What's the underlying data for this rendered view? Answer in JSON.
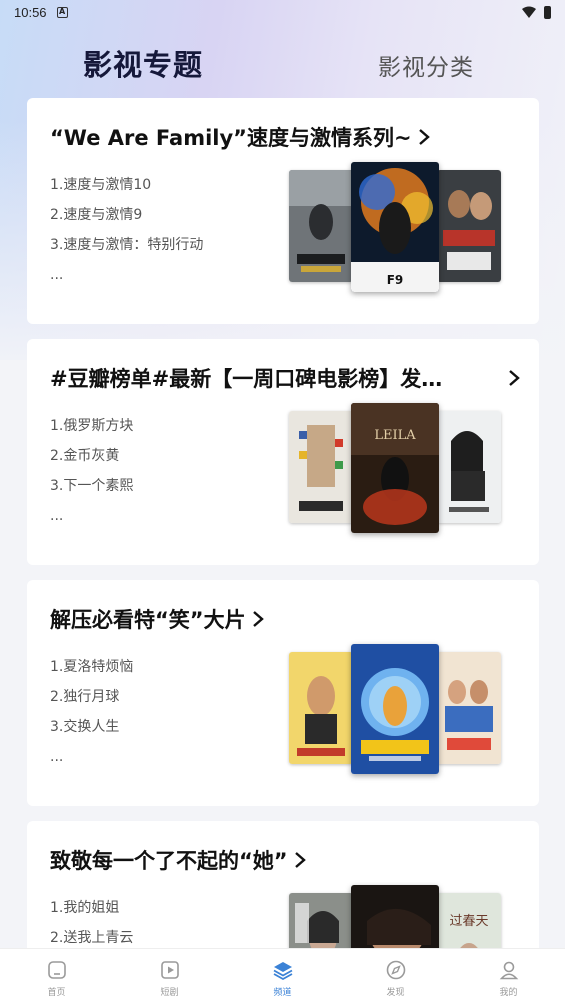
{
  "status": {
    "time": "10:56"
  },
  "tabs": {
    "active": "影视专题",
    "inactive": "影视分类"
  },
  "cards": [
    {
      "title": "“We Are Family”速度与激情系列~",
      "items": [
        "1.速度与激情10",
        "2.速度与激情9",
        "3.速度与激情：特别行动",
        "..."
      ]
    },
    {
      "title": "#豆瓣榜单#最新【一周口碑电影榜】发…",
      "items": [
        "1.俄罗斯方块",
        "2.金币灰黄",
        "3.下一个素熙",
        "..."
      ]
    },
    {
      "title": "解压必看特“笑”大片",
      "items": [
        "1.夏洛特烦恼",
        "2.独行月球",
        "3.交换人生",
        "..."
      ]
    },
    {
      "title": "致敬每一个了不起的“她”",
      "items": [
        "1.我的姐姐",
        "2.送我上青云"
      ]
    }
  ],
  "bottom_nav": [
    {
      "label": "首页",
      "icon": "home-icon"
    },
    {
      "label": "短剧",
      "icon": "play-icon"
    },
    {
      "label": "频道",
      "icon": "layers-icon"
    },
    {
      "label": "发现",
      "icon": "compass-icon"
    },
    {
      "label": "我的",
      "icon": "user-icon"
    }
  ],
  "colors": {
    "accent": "#3b82d6",
    "title": "#15183a",
    "background": "#f3f4f8"
  }
}
